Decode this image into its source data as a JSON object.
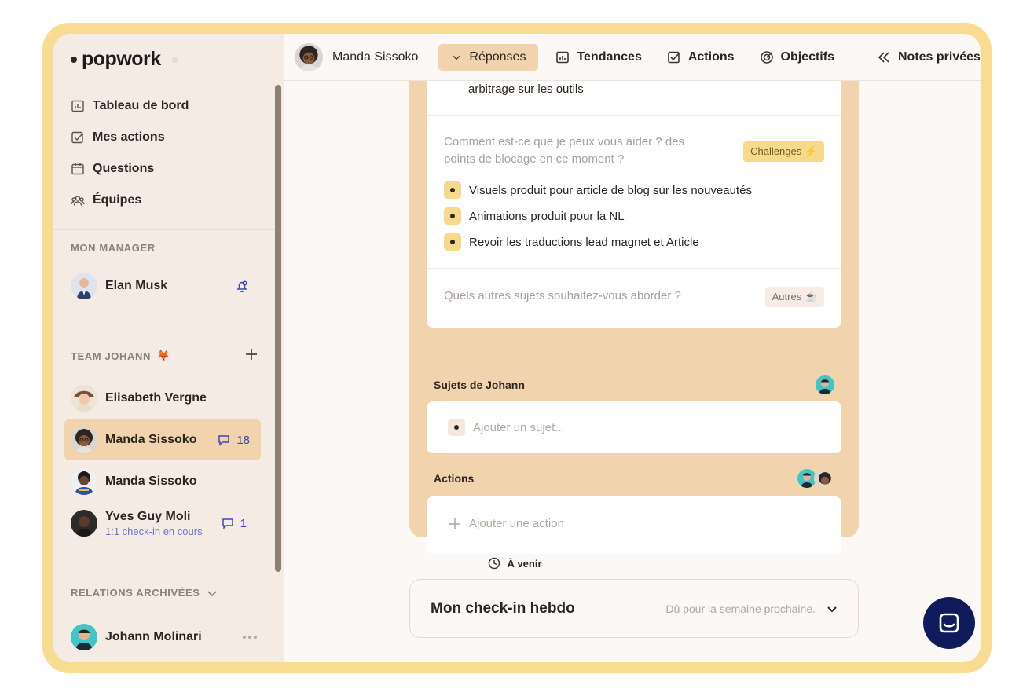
{
  "app": {
    "logo_text": "popwork"
  },
  "nav": [
    {
      "label": "Tableau de bord",
      "icon": "chart-icon"
    },
    {
      "label": "Mes actions",
      "icon": "checkbox-icon"
    },
    {
      "label": "Questions",
      "icon": "calendar-icon"
    },
    {
      "label": "Équipes",
      "icon": "team-icon"
    }
  ],
  "manager": {
    "title": "MON MANAGER",
    "name": "Elan Musk"
  },
  "team": {
    "title": "TEAM JOHANN",
    "emoji": "🦊",
    "members": [
      {
        "name": "Elisabeth Vergne",
        "sub": "",
        "count": ""
      },
      {
        "name": "Manda Sissoko",
        "sub": "",
        "count": "18"
      },
      {
        "name": "Manda Sissoko",
        "sub": "",
        "count": ""
      },
      {
        "name": "Yves Guy Moli",
        "sub": "1:1 check-in en cours",
        "count": "1"
      }
    ]
  },
  "archived": {
    "title": "RELATIONS ARCHIVÉES",
    "name": "Johann Molinari"
  },
  "topbar": {
    "user": "Manda Sissoko",
    "tabs": [
      "Réponses",
      "Tendances",
      "Actions",
      "Objectifs",
      "Notes privées"
    ]
  },
  "answers": {
    "prev_line": "arbitrage sur les outils",
    "q1_line1": "Comment est-ce que je peux vous aider ? des",
    "q1_line2": "points de blocage en ce moment ?",
    "q1_tag": "Challenges ⚡",
    "q1_items": [
      "Visuels produit pour article de blog sur les nouveautés",
      "Animations produit pour la NL",
      "Revoir les traductions lead magnet et Article"
    ],
    "q2": "Quels autres sujets souhaitez-vous aborder ?",
    "q2_tag": "Autres ☕"
  },
  "subjects": {
    "title": "Sujets de Johann",
    "placeholder": "Ajouter un sujet..."
  },
  "actions": {
    "title": "Actions",
    "placeholder": "Ajouter une action"
  },
  "upcoming": {
    "label": "À venir"
  },
  "checkin": {
    "title": "Mon check-in hebdo",
    "due": "Dû pour la semaine prochaine."
  },
  "colors": {
    "accent": "#f1d3ad",
    "frame": "#f8dc92",
    "link": "#3d46b3",
    "chat": "#101b5c"
  }
}
